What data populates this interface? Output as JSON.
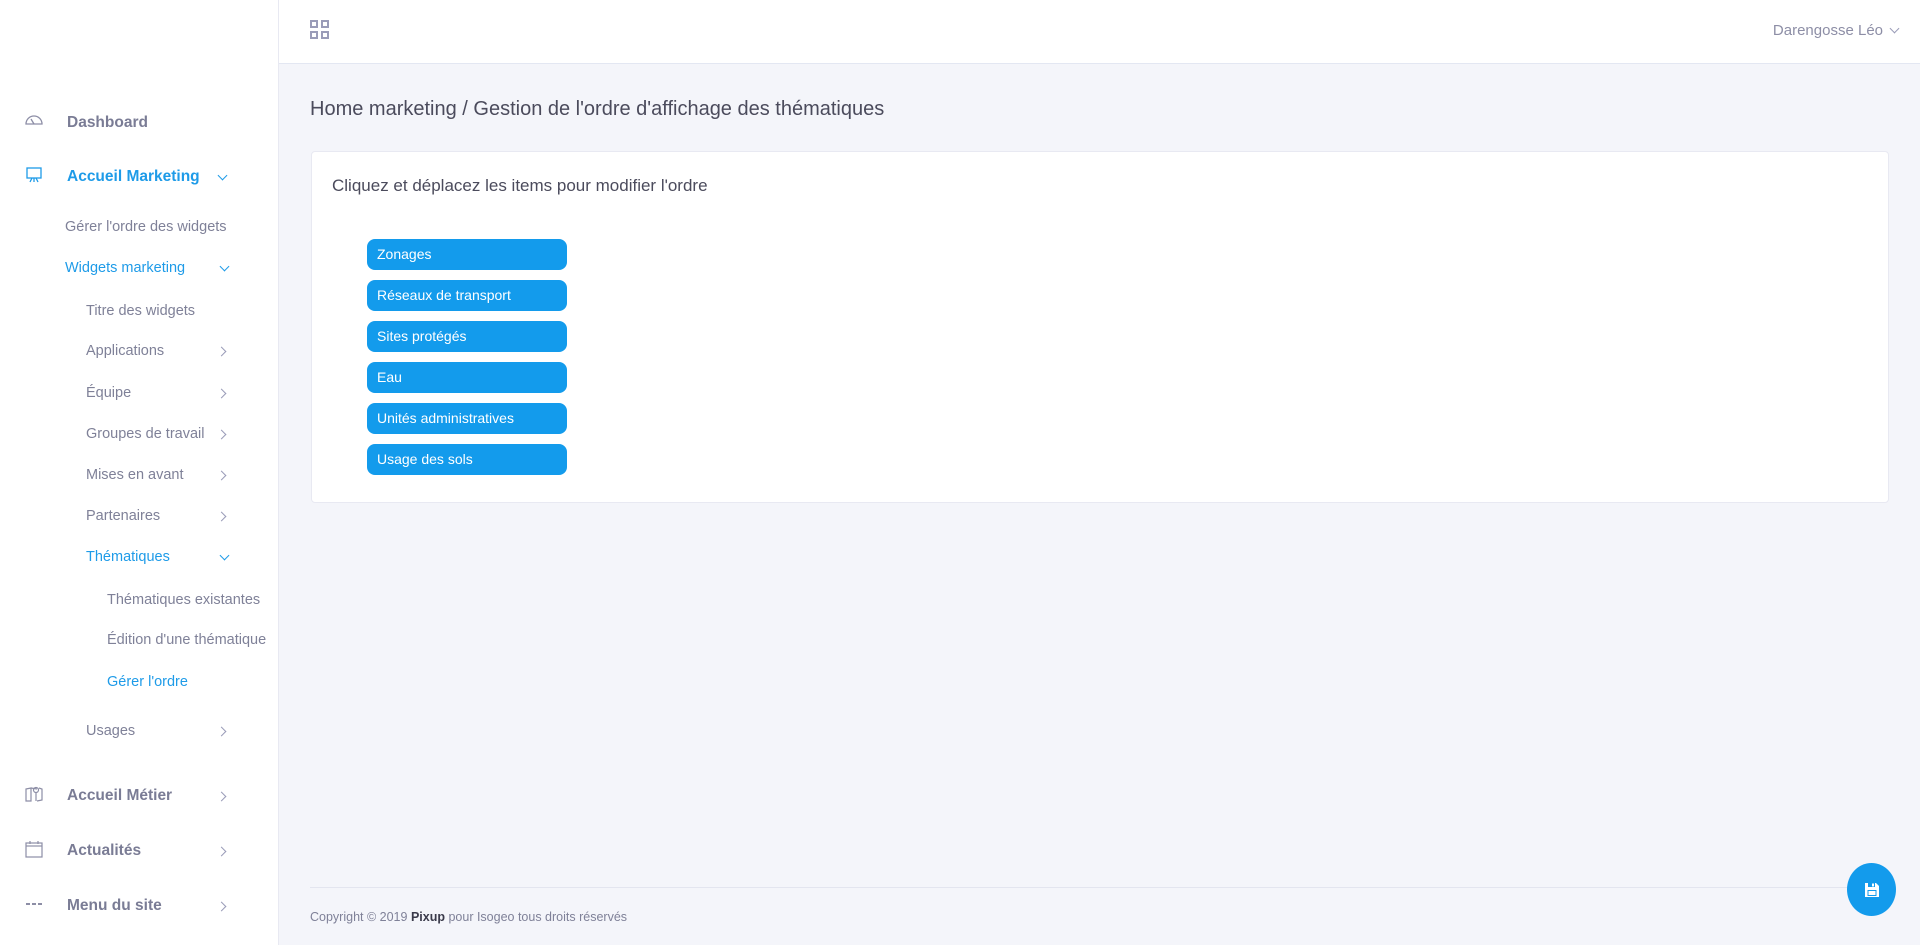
{
  "header": {
    "user_name": "Darengosse Léo"
  },
  "sidebar": {
    "items": [
      {
        "label": "Dashboard",
        "icon": "dashboard-gauge-icon"
      },
      {
        "label": "Accueil Marketing",
        "icon": "presentation-board-icon",
        "expanded": true
      },
      {
        "label": "Gérer l'ordre des widgets"
      },
      {
        "label": "Widgets marketing",
        "expanded": true
      },
      {
        "label": "Titre des widgets"
      },
      {
        "label": "Applications"
      },
      {
        "label": "Équipe"
      },
      {
        "label": "Groupes de travail"
      },
      {
        "label": "Mises en avant"
      },
      {
        "label": "Partenaires"
      },
      {
        "label": "Thématiques",
        "expanded": true
      },
      {
        "label": "Thématiques existantes"
      },
      {
        "label": "Édition d'une thématique"
      },
      {
        "label": "Gérer l'ordre",
        "active": true
      },
      {
        "label": "Usages"
      },
      {
        "label": "Accueil Métier",
        "icon": "map-pin-icon"
      },
      {
        "label": "Actualités",
        "icon": "calendar-icon"
      },
      {
        "label": "Menu du site",
        "icon": "menu-dots-icon"
      }
    ]
  },
  "main": {
    "breadcrumb": "Home marketing / Gestion de l'ordre d'affichage des thématiques",
    "card_title": "Cliquez et déplacez les items pour modifier l'ordre",
    "items": [
      "Zonages",
      "Réseaux de transport",
      "Sites protégés",
      "Eau",
      "Unités administratives",
      "Usage des sols"
    ]
  },
  "footer": {
    "prefix": "Copyright © 2019 ",
    "brand": "Pixup",
    "suffix": " pour Isogeo tous droits réservés"
  },
  "colors": {
    "accent": "#139bec",
    "active_text": "#1e9be8"
  },
  "save_button": {
    "icon": "floppy-disk-icon"
  }
}
